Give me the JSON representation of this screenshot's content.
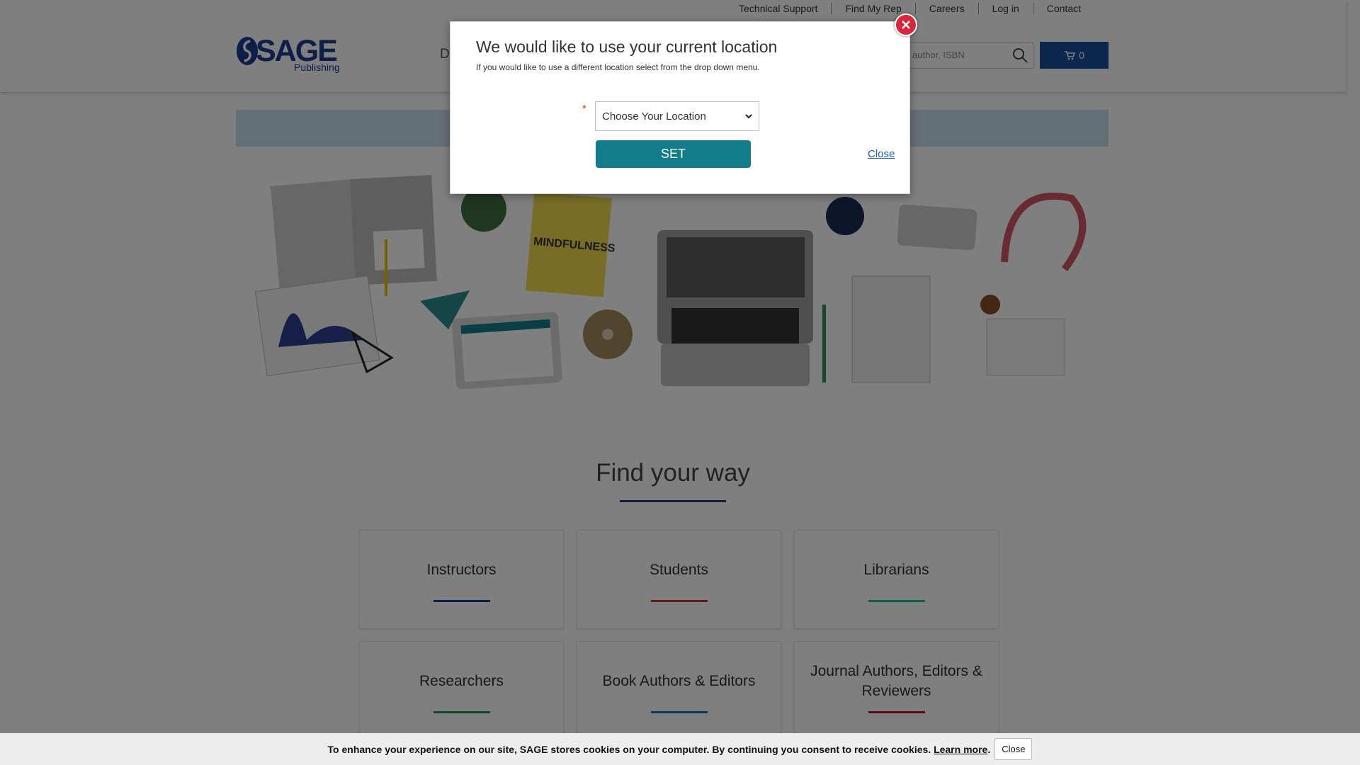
{
  "utility_nav": [
    "Technical Support",
    "Find My Rep",
    "Careers",
    "Log in",
    "Contact"
  ],
  "logo": {
    "name": "SAGE",
    "sub": "Publishing"
  },
  "nav_fragment": "D",
  "search": {
    "value": "author, ISBN"
  },
  "cart": {
    "count": "0"
  },
  "find": {
    "title": "Find your way"
  },
  "cards": [
    {
      "label": "Instructors",
      "rule_color": "#1d3c8f"
    },
    {
      "label": "Students",
      "rule_color": "#c0392b"
    },
    {
      "label": "Librarians",
      "rule_color": "#1abc9c"
    },
    {
      "label": "Researchers",
      "rule_color": "#2e8b57"
    },
    {
      "label": "Book Authors & Editors",
      "rule_color": "#1f6fb2"
    },
    {
      "label": "Journal Authors, Editors & Reviewers",
      "rule_color": "#b0142a"
    }
  ],
  "modal": {
    "title": "We would like to use your current location",
    "subtitle": "If you would like to use a different location select from the drop down menu.",
    "required_mark": "*",
    "select_value": "Choose Your Location",
    "set_label": "SET",
    "close_label": "Close"
  },
  "cookie": {
    "text": "To enhance your experience on our site, SAGE stores cookies on your computer. By continuing you consent to receive cookies.",
    "learn_more": "Learn more",
    "close_label": "Close"
  },
  "hero_book_title": "MINDFULNESS",
  "colors": {
    "brand": "#1d3c8f",
    "cart": "#1d4fa0",
    "set_button": "#127d8a",
    "close_x": "#d9263a"
  }
}
